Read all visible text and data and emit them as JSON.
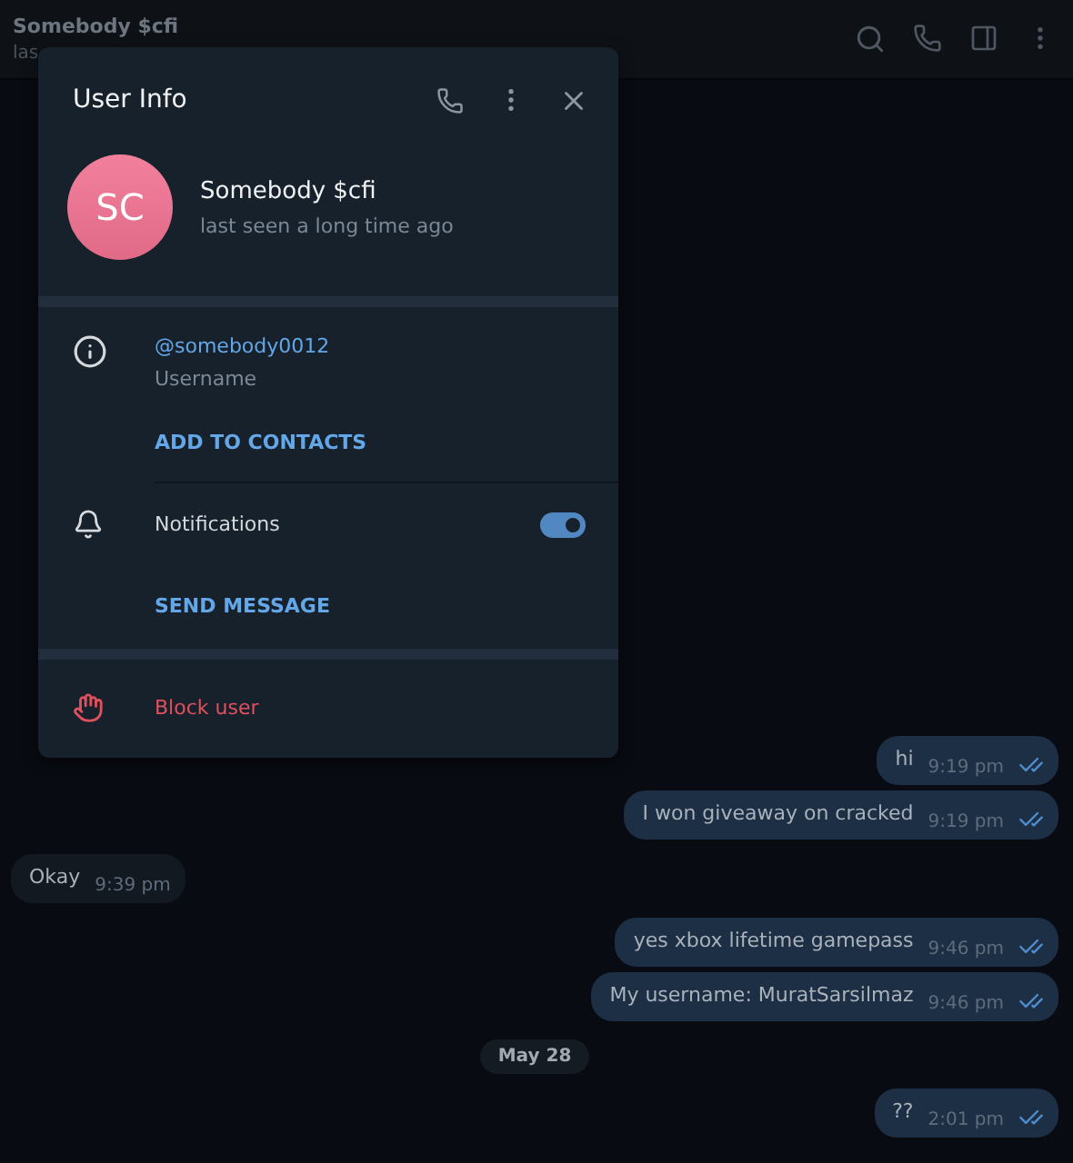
{
  "chat_header": {
    "title": "Somebody $cfi",
    "subtitle": "las"
  },
  "messages": [
    {
      "kind": "outgoing",
      "text": "hi",
      "time": "9:19 pm"
    },
    {
      "kind": "outgoing",
      "text": "I won giveaway on cracked",
      "time": "9:19 pm"
    },
    {
      "kind": "incoming",
      "text": "Okay",
      "time": "9:39 pm"
    },
    {
      "kind": "outgoing",
      "text": "yes xbox lifetime gamepass",
      "time": "9:46 pm"
    },
    {
      "kind": "outgoing",
      "text": "My username: MuratSarsilmaz",
      "time": "9:46 pm"
    },
    {
      "kind": "date",
      "text": "May 28"
    },
    {
      "kind": "outgoing",
      "text": "??",
      "time": "2:01 pm"
    }
  ],
  "user_info": {
    "title": "User Info",
    "avatar_initials": "SC",
    "name": "Somebody $cfi",
    "status": "last seen a long time ago",
    "username": "@somebody0012",
    "username_label": "Username",
    "add_contact": "ADD TO CONTACTS",
    "notifications": {
      "label": "Notifications",
      "on": true
    },
    "send_message": "SEND MESSAGE",
    "block": "Block user"
  }
}
